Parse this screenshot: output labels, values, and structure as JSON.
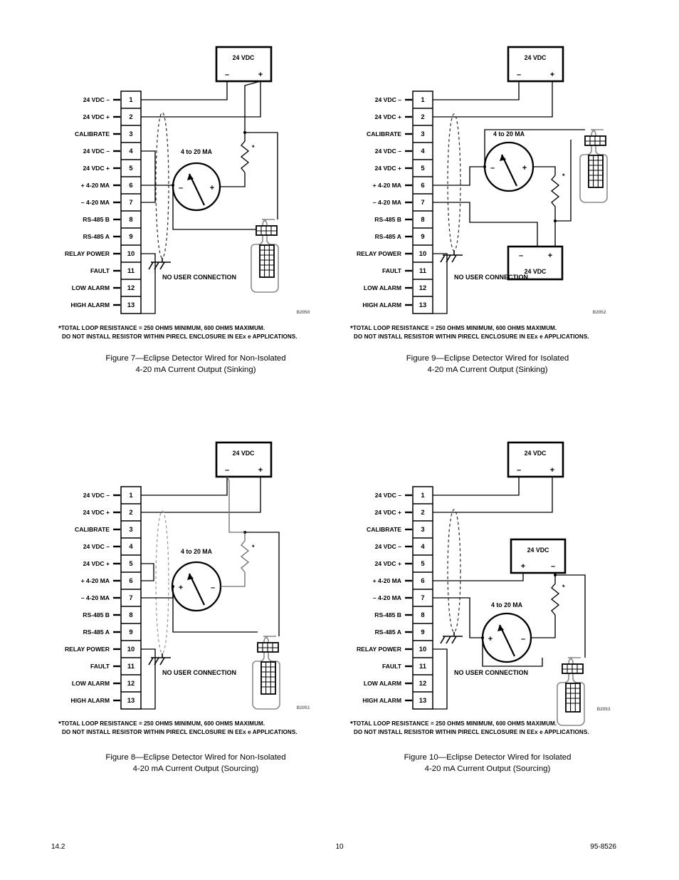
{
  "document": {
    "footer": {
      "left": "14.2",
      "center": "10",
      "right": "95-8526"
    }
  },
  "common": {
    "terminal_labels": [
      "24 VDC –",
      "24 VDC +",
      "CALIBRATE",
      "24 VDC –",
      "24 VDC +",
      "+ 4-20 MA",
      "– 4-20 MA",
      "RS-485 B",
      "RS-485 A",
      "RELAY POWER",
      "FAULT",
      "LOW ALARM",
      "HIGH ALARM"
    ],
    "terminal_numbers": [
      "1",
      "2",
      "3",
      "4",
      "5",
      "6",
      "7",
      "8",
      "9",
      "10",
      "11",
      "12",
      "13"
    ],
    "no_user_connection": "NO USER CONNECTION",
    "meter_label": "4 to 20 MA",
    "supply_label": "24 VDC",
    "minus": "–",
    "plus": "+",
    "star": "*",
    "footnote_line1": "TOTAL LOOP RESISTANCE = 250 OHMS MINIMUM, 600 OHMS MAXIMUM.",
    "footnote_line2": "DO NOT INSTALL RESISTOR WITHIN PIRECL ENCLOSURE IN EEx e APPLICATIONS."
  },
  "figures": [
    {
      "id": "figure-7",
      "drawing_number": "B2050",
      "caption_line1": "Figure 7—Eclipse Detector Wired for Non-Isolated",
      "caption_line2": "4-20 mA Current Output (Sinking)",
      "supply_label": "24 VDC",
      "supply_left_polarity": "–",
      "supply_right_polarity": "+",
      "meter_left_polarity": "–",
      "meter_right_polarity": "+",
      "second_supply": false
    },
    {
      "id": "figure-9",
      "drawing_number": "B2052",
      "caption_line1": "Figure 9—Eclipse Detector Wired for Isolated",
      "caption_line2": "4-20 mA Current Output (Sinking)",
      "supply_label": "24 VDC",
      "supply_left_polarity": "–",
      "supply_right_polarity": "+",
      "meter_left_polarity": "–",
      "meter_right_polarity": "+",
      "second_supply": true,
      "second_supply_label": "24 VDC",
      "second_supply_left_polarity": "–",
      "second_supply_right_polarity": "+"
    },
    {
      "id": "figure-8",
      "drawing_number": "B2051",
      "caption_line1": "Figure 8—Eclipse Detector Wired for Non-Isolated",
      "caption_line2": "4-20 mA Current Output (Sourcing)",
      "supply_label": "24 VDC",
      "supply_left_polarity": "–",
      "supply_right_polarity": "+",
      "meter_left_polarity": "+",
      "meter_right_polarity": "–",
      "second_supply": false
    },
    {
      "id": "figure-10",
      "drawing_number": "B2053",
      "caption_line1": "Figure 10—Eclipse Detector Wired for Isolated",
      "caption_line2": "4-20 mA Current Output (Sourcing)",
      "supply_label": "24 VDC",
      "supply_left_polarity": "–",
      "supply_right_polarity": "+",
      "meter_left_polarity": "+",
      "meter_right_polarity": "–",
      "second_supply": true,
      "second_supply_label": "24 VDC",
      "second_supply_left_polarity": "+",
      "second_supply_right_polarity": "–"
    }
  ]
}
